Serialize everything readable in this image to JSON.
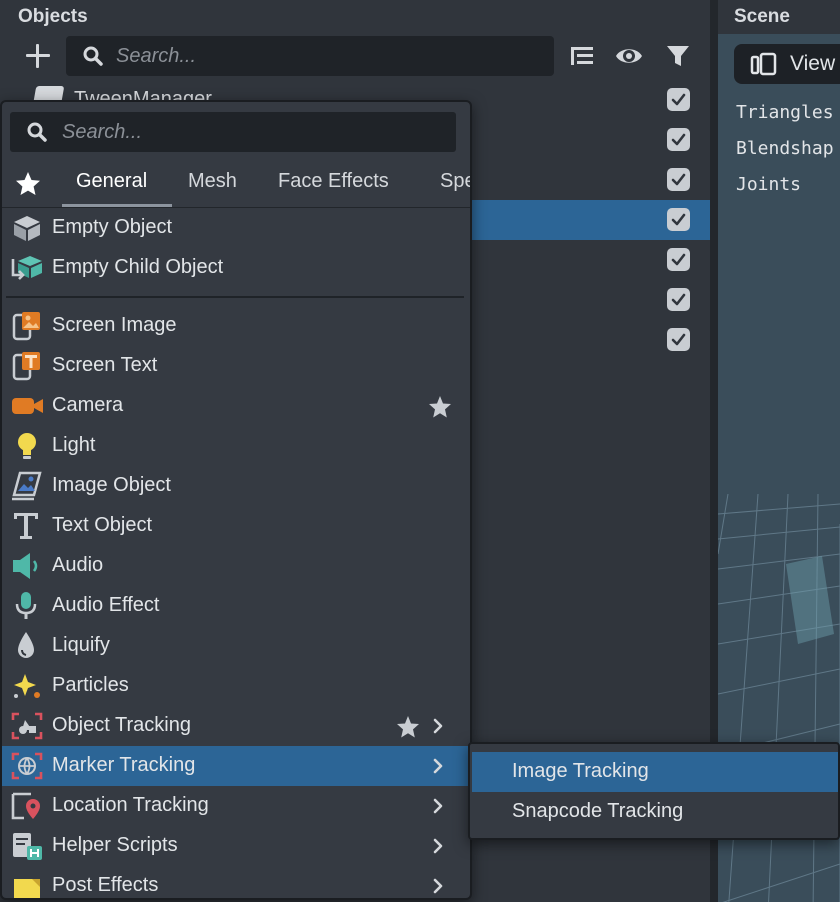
{
  "objects_panel": {
    "title": "Objects",
    "search_placeholder": "Search...",
    "partial_row_name": "TweenManager",
    "checkboxes": [
      true,
      true,
      true,
      true,
      true,
      true,
      true
    ]
  },
  "scene_panel": {
    "title": "Scene",
    "view_button_label": "View",
    "stats": [
      "Triangles",
      "Blendshap",
      "Joints"
    ]
  },
  "add_menu": {
    "search_placeholder": "Search...",
    "tabs": [
      "General",
      "Mesh",
      "Face Effects",
      "Spe"
    ],
    "active_tab": "General",
    "items": [
      {
        "label": "Empty Object",
        "icon": "empty-object-icon",
        "favorite": false,
        "submenu": false
      },
      {
        "label": "Empty Child Object",
        "icon": "empty-child-object-icon",
        "favorite": false,
        "submenu": false
      },
      {
        "label": "Screen Image",
        "icon": "screen-image-icon",
        "favorite": false,
        "submenu": false
      },
      {
        "label": "Screen Text",
        "icon": "screen-text-icon",
        "favorite": false,
        "submenu": false
      },
      {
        "label": "Camera",
        "icon": "camera-icon",
        "favorite": true,
        "submenu": false
      },
      {
        "label": "Light",
        "icon": "light-icon",
        "favorite": false,
        "submenu": false
      },
      {
        "label": "Image Object",
        "icon": "image-object-icon",
        "favorite": false,
        "submenu": false
      },
      {
        "label": "Text Object",
        "icon": "text-object-icon",
        "favorite": false,
        "submenu": false
      },
      {
        "label": "Audio",
        "icon": "audio-icon",
        "favorite": false,
        "submenu": false
      },
      {
        "label": "Audio Effect",
        "icon": "audio-effect-icon",
        "favorite": false,
        "submenu": false
      },
      {
        "label": "Liquify",
        "icon": "liquify-icon",
        "favorite": false,
        "submenu": false
      },
      {
        "label": "Particles",
        "icon": "particles-icon",
        "favorite": false,
        "submenu": false
      },
      {
        "label": "Object Tracking",
        "icon": "object-tracking-icon",
        "favorite": true,
        "submenu": true
      },
      {
        "label": "Marker Tracking",
        "icon": "marker-tracking-icon",
        "favorite": false,
        "submenu": true,
        "selected": true
      },
      {
        "label": "Location Tracking",
        "icon": "location-tracking-icon",
        "favorite": false,
        "submenu": true
      },
      {
        "label": "Helper Scripts",
        "icon": "helper-scripts-icon",
        "favorite": false,
        "submenu": true
      },
      {
        "label": "Post Effects",
        "icon": "post-effects-icon",
        "favorite": false,
        "submenu": true
      }
    ]
  },
  "submenu": {
    "items": [
      {
        "label": "Image Tracking",
        "selected": true
      },
      {
        "label": "Snapcode Tracking",
        "selected": false
      }
    ]
  },
  "colors": {
    "panel_bg": "#30353c",
    "menu_bg": "#353a42",
    "selection": "#2c6596",
    "accent_orange": "#e07b24",
    "accent_teal": "#4fb8a8",
    "accent_red": "#d9525e",
    "accent_yellow": "#f2d94e"
  }
}
